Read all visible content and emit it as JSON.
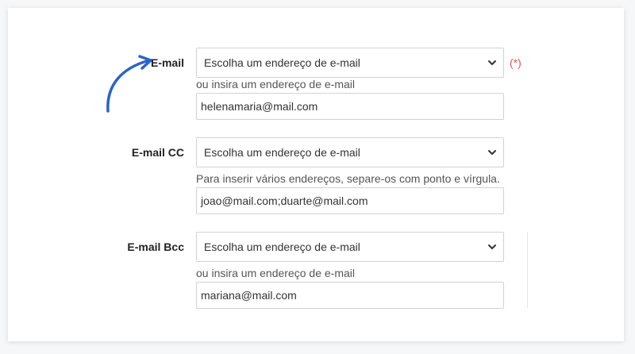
{
  "colors": {
    "accent_arrow": "#2a64c8",
    "required": "#e05a4e"
  },
  "fields": [
    {
      "label": "E-mail",
      "select_value": "Escolha um endereço de e-mail",
      "required_mark": "(*)",
      "hint": "ou insira um endereço de e-mail",
      "input_value": "helenamaria@mail.com"
    },
    {
      "label": "E-mail CC",
      "select_value": "Escolha um endereço de e-mail",
      "hint": "Para inserir vários endereços, separe-os com ponto e vírgula.",
      "input_value": "joao@mail.com;duarte@mail.com"
    },
    {
      "label": "E-mail Bcc",
      "select_value": "Escolha um endereço de e-mail",
      "hint": "ou insira um endereço de e-mail",
      "input_value": "mariana@mail.com"
    }
  ],
  "icons": {
    "dropdown": "chevron-down-icon",
    "pointer": "curved-arrow-icon"
  }
}
